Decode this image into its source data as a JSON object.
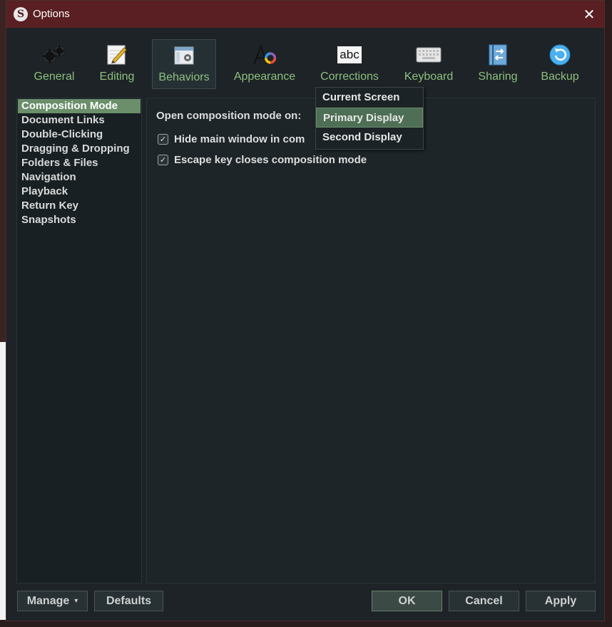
{
  "window": {
    "title": "Options",
    "app_icon": "S"
  },
  "toolbar": {
    "items": [
      {
        "label": "General",
        "icon": "gears-icon"
      },
      {
        "label": "Editing",
        "icon": "pencil-icon"
      },
      {
        "label": "Behaviors",
        "icon": "window-gear-icon",
        "selected": true
      },
      {
        "label": "Appearance",
        "icon": "font-color-icon"
      },
      {
        "label": "Corrections",
        "icon": "abc-icon",
        "text": "abc"
      },
      {
        "label": "Keyboard",
        "icon": "keyboard-icon"
      },
      {
        "label": "Sharing",
        "icon": "sharing-icon"
      },
      {
        "label": "Backup",
        "icon": "backup-icon"
      }
    ]
  },
  "sidebar": {
    "items": [
      "Composition Mode",
      "Document Links",
      "Double-Clicking",
      "Dragging & Dropping",
      "Folders & Files",
      "Navigation",
      "Playback",
      "Return Key",
      "Snapshots"
    ],
    "selected_index": 0
  },
  "content": {
    "open_label": "Open composition mode on:",
    "hide_main_label": "Hide main window in com",
    "hide_main_checked": true,
    "escape_label": "Escape key closes composition mode",
    "escape_checked": true
  },
  "dropdown": {
    "options": [
      "Current Screen",
      "Primary Display",
      "Second Display"
    ],
    "selected_index": 1
  },
  "buttons": {
    "manage": "Manage",
    "manage_arrow": "▾",
    "defaults": "Defaults",
    "ok": "OK",
    "cancel": "Cancel",
    "apply": "Apply"
  },
  "colors": {
    "titlebar": "#5a1f22",
    "accent_green": "#8fbf7f",
    "selected_sidebar": "#6a8f6a"
  }
}
